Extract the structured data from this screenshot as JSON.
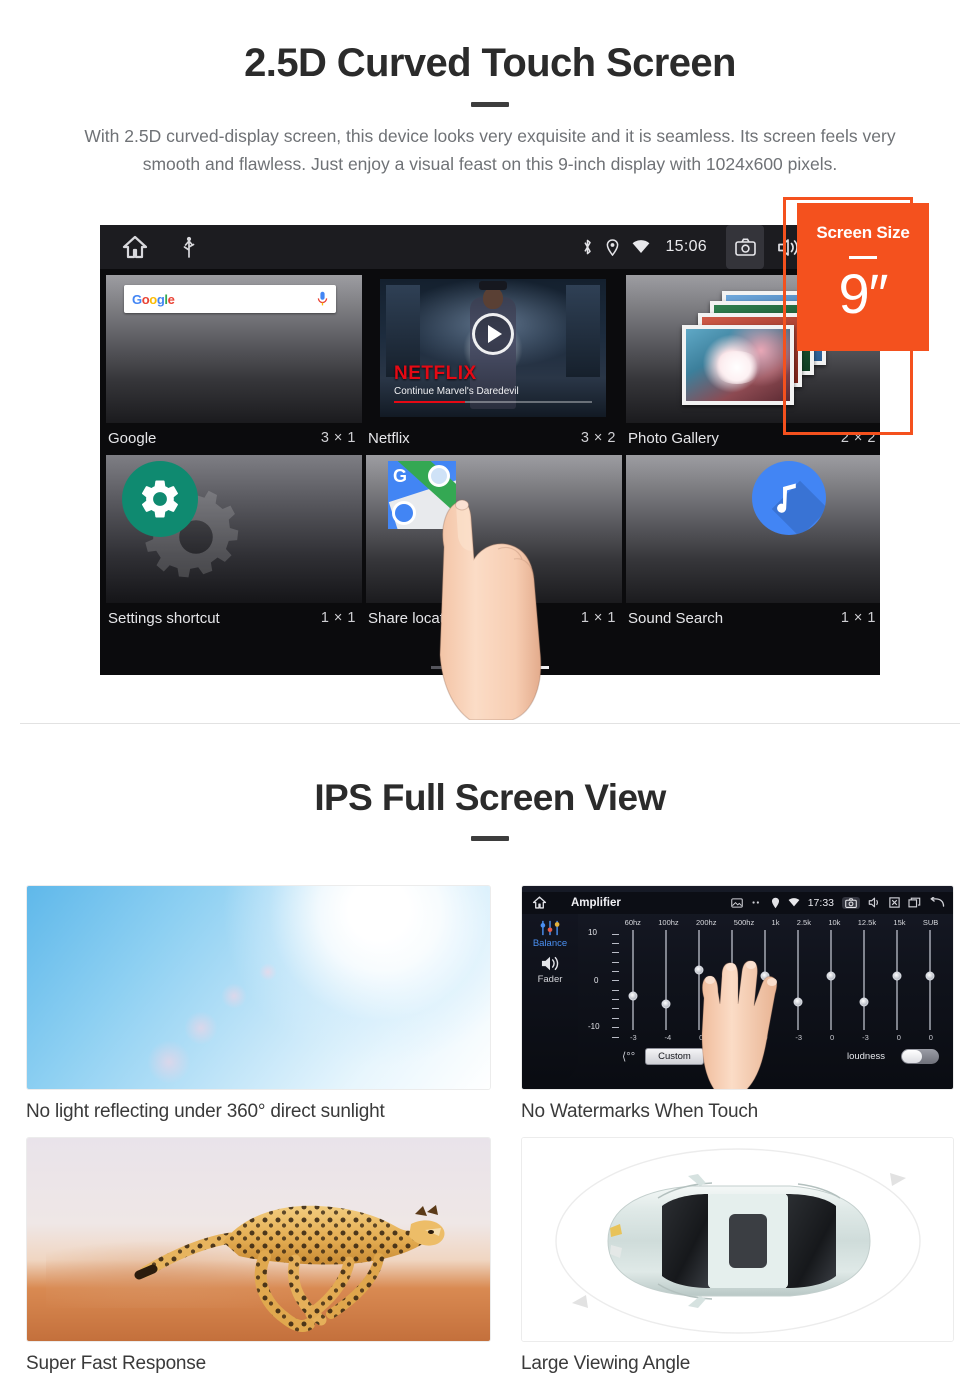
{
  "section_one": {
    "title": "2.5D Curved Touch Screen",
    "paragraph": "With 2.5D curved-display screen, this device looks very exquisite and it is seamless. Its screen feels very smooth and flawless. Just enjoy a visual feast on this 9-inch display with 1024x600 pixels.",
    "badge": {
      "label": "Screen Size",
      "value": "9″",
      "color": "#f4511e"
    },
    "device": {
      "status_bar": {
        "time": "15:06",
        "icons_left": [
          "home-icon",
          "usb-icon"
        ],
        "icons_right": [
          "bluetooth-icon",
          "location-icon",
          "wifi-icon",
          "camera-icon",
          "volume-icon",
          "close-box-icon",
          "recents-icon"
        ]
      },
      "widgets": [
        {
          "name": "Google",
          "size": "3 × 1",
          "icon": "google-search-widget"
        },
        {
          "name": "Netflix",
          "size": "3 × 2",
          "icon": "netflix-widget"
        },
        {
          "name": "Photo Gallery",
          "size": "2 × 2",
          "icon": "photo-gallery-widget"
        },
        {
          "name": "Settings shortcut",
          "size": "1 × 1",
          "icon": "settings-gear-widget"
        },
        {
          "name": "Share location",
          "size": "1 × 1",
          "icon": "google-maps-widget"
        },
        {
          "name": "Sound Search",
          "size": "1 × 1",
          "icon": "sound-search-widget"
        }
      ],
      "netflix_tile": {
        "brand": "NETFLIX",
        "subtitle": "Continue Marvel's Daredevil"
      },
      "google_widget": {
        "brand_letters": [
          "G",
          "o",
          "o",
          "g",
          "l",
          "e"
        ],
        "mic_icon": "microphone-icon"
      },
      "page_indicator": {
        "count": 3,
        "active_index": 2
      }
    }
  },
  "section_two": {
    "title": "IPS Full Screen View",
    "cards": [
      {
        "caption": "No light reflecting under 360° direct sunlight",
        "image": "sunlight-sky-photo"
      },
      {
        "caption": "No Watermarks When Touch",
        "image": "amplifier-equalizer-screenshot"
      },
      {
        "caption": "Super Fast Response",
        "image": "running-cheetah-photo"
      },
      {
        "caption": "Large Viewing Angle",
        "image": "car-top-view-illustration"
      }
    ],
    "amplifier": {
      "title": "Amplifier",
      "time": "17:33",
      "side_labels": [
        "Balance",
        "Fader"
      ],
      "scale_top": "10",
      "scale_mid": "0",
      "scale_bottom": "-10",
      "bands": [
        "60hz",
        "100hz",
        "200hz",
        "500hz",
        "1k",
        "2.5k",
        "10k",
        "12.5k",
        "15k",
        "SUB"
      ],
      "values": [
        "-3",
        "-4",
        "0",
        "0",
        "0",
        "-3",
        "0",
        "-3",
        "0",
        "0"
      ],
      "preset_button": "Custom",
      "loudness_label": "loudness",
      "back_icon": "back-arrow-icon"
    }
  }
}
